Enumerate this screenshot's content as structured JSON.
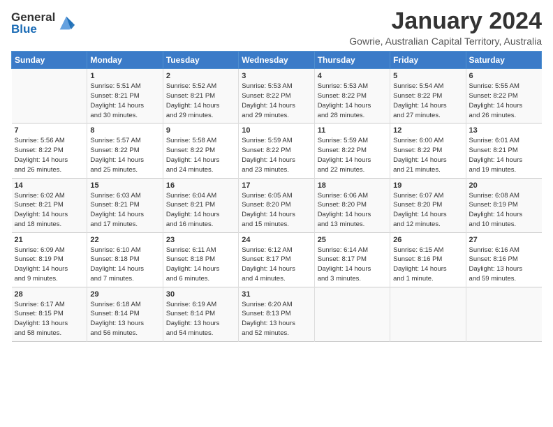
{
  "logo": {
    "general": "General",
    "blue": "Blue"
  },
  "title": "January 2024",
  "location": "Gowrie, Australian Capital Territory, Australia",
  "days_header": [
    "Sunday",
    "Monday",
    "Tuesday",
    "Wednesday",
    "Thursday",
    "Friday",
    "Saturday"
  ],
  "weeks": [
    [
      {
        "day": "",
        "info": ""
      },
      {
        "day": "1",
        "info": "Sunrise: 5:51 AM\nSunset: 8:21 PM\nDaylight: 14 hours\nand 30 minutes."
      },
      {
        "day": "2",
        "info": "Sunrise: 5:52 AM\nSunset: 8:21 PM\nDaylight: 14 hours\nand 29 minutes."
      },
      {
        "day": "3",
        "info": "Sunrise: 5:53 AM\nSunset: 8:22 PM\nDaylight: 14 hours\nand 29 minutes."
      },
      {
        "day": "4",
        "info": "Sunrise: 5:53 AM\nSunset: 8:22 PM\nDaylight: 14 hours\nand 28 minutes."
      },
      {
        "day": "5",
        "info": "Sunrise: 5:54 AM\nSunset: 8:22 PM\nDaylight: 14 hours\nand 27 minutes."
      },
      {
        "day": "6",
        "info": "Sunrise: 5:55 AM\nSunset: 8:22 PM\nDaylight: 14 hours\nand 26 minutes."
      }
    ],
    [
      {
        "day": "7",
        "info": "Sunrise: 5:56 AM\nSunset: 8:22 PM\nDaylight: 14 hours\nand 26 minutes."
      },
      {
        "day": "8",
        "info": "Sunrise: 5:57 AM\nSunset: 8:22 PM\nDaylight: 14 hours\nand 25 minutes."
      },
      {
        "day": "9",
        "info": "Sunrise: 5:58 AM\nSunset: 8:22 PM\nDaylight: 14 hours\nand 24 minutes."
      },
      {
        "day": "10",
        "info": "Sunrise: 5:59 AM\nSunset: 8:22 PM\nDaylight: 14 hours\nand 23 minutes."
      },
      {
        "day": "11",
        "info": "Sunrise: 5:59 AM\nSunset: 8:22 PM\nDaylight: 14 hours\nand 22 minutes."
      },
      {
        "day": "12",
        "info": "Sunrise: 6:00 AM\nSunset: 8:22 PM\nDaylight: 14 hours\nand 21 minutes."
      },
      {
        "day": "13",
        "info": "Sunrise: 6:01 AM\nSunset: 8:21 PM\nDaylight: 14 hours\nand 19 minutes."
      }
    ],
    [
      {
        "day": "14",
        "info": "Sunrise: 6:02 AM\nSunset: 8:21 PM\nDaylight: 14 hours\nand 18 minutes."
      },
      {
        "day": "15",
        "info": "Sunrise: 6:03 AM\nSunset: 8:21 PM\nDaylight: 14 hours\nand 17 minutes."
      },
      {
        "day": "16",
        "info": "Sunrise: 6:04 AM\nSunset: 8:21 PM\nDaylight: 14 hours\nand 16 minutes."
      },
      {
        "day": "17",
        "info": "Sunrise: 6:05 AM\nSunset: 8:20 PM\nDaylight: 14 hours\nand 15 minutes."
      },
      {
        "day": "18",
        "info": "Sunrise: 6:06 AM\nSunset: 8:20 PM\nDaylight: 14 hours\nand 13 minutes."
      },
      {
        "day": "19",
        "info": "Sunrise: 6:07 AM\nSunset: 8:20 PM\nDaylight: 14 hours\nand 12 minutes."
      },
      {
        "day": "20",
        "info": "Sunrise: 6:08 AM\nSunset: 8:19 PM\nDaylight: 14 hours\nand 10 minutes."
      }
    ],
    [
      {
        "day": "21",
        "info": "Sunrise: 6:09 AM\nSunset: 8:19 PM\nDaylight: 14 hours\nand 9 minutes."
      },
      {
        "day": "22",
        "info": "Sunrise: 6:10 AM\nSunset: 8:18 PM\nDaylight: 14 hours\nand 7 minutes."
      },
      {
        "day": "23",
        "info": "Sunrise: 6:11 AM\nSunset: 8:18 PM\nDaylight: 14 hours\nand 6 minutes."
      },
      {
        "day": "24",
        "info": "Sunrise: 6:12 AM\nSunset: 8:17 PM\nDaylight: 14 hours\nand 4 minutes."
      },
      {
        "day": "25",
        "info": "Sunrise: 6:14 AM\nSunset: 8:17 PM\nDaylight: 14 hours\nand 3 minutes."
      },
      {
        "day": "26",
        "info": "Sunrise: 6:15 AM\nSunset: 8:16 PM\nDaylight: 14 hours\nand 1 minute."
      },
      {
        "day": "27",
        "info": "Sunrise: 6:16 AM\nSunset: 8:16 PM\nDaylight: 13 hours\nand 59 minutes."
      }
    ],
    [
      {
        "day": "28",
        "info": "Sunrise: 6:17 AM\nSunset: 8:15 PM\nDaylight: 13 hours\nand 58 minutes."
      },
      {
        "day": "29",
        "info": "Sunrise: 6:18 AM\nSunset: 8:14 PM\nDaylight: 13 hours\nand 56 minutes."
      },
      {
        "day": "30",
        "info": "Sunrise: 6:19 AM\nSunset: 8:14 PM\nDaylight: 13 hours\nand 54 minutes."
      },
      {
        "day": "31",
        "info": "Sunrise: 6:20 AM\nSunset: 8:13 PM\nDaylight: 13 hours\nand 52 minutes."
      },
      {
        "day": "",
        "info": ""
      },
      {
        "day": "",
        "info": ""
      },
      {
        "day": "",
        "info": ""
      }
    ]
  ]
}
